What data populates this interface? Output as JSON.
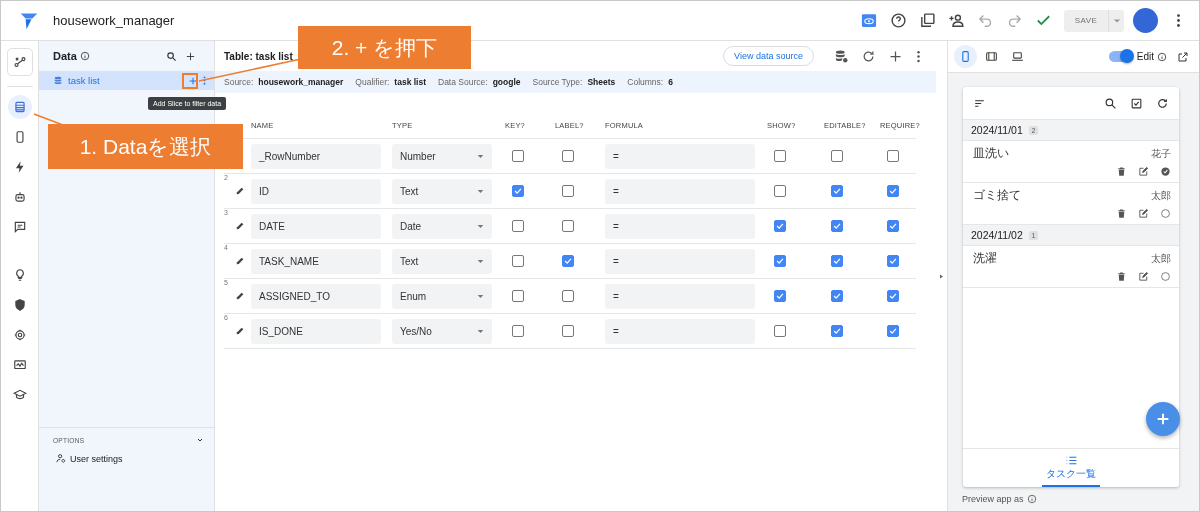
{
  "app": {
    "title": "housework_manager",
    "save": {
      "label": "SAVE",
      "disabled": true
    }
  },
  "rail": {
    "top": {
      "kind": "flow",
      "selected": false
    },
    "groups": [
      [
        {
          "kind": "data",
          "selected": true
        },
        {
          "kind": "phone",
          "selected": false
        },
        {
          "kind": "bolt",
          "selected": false
        },
        {
          "kind": "bot",
          "selected": false
        },
        {
          "kind": "chat",
          "selected": false
        }
      ],
      [
        {
          "kind": "bulb",
          "selected": false
        },
        {
          "kind": "shield",
          "selected": false
        },
        {
          "kind": "gear",
          "selected": false
        },
        {
          "kind": "monitor",
          "selected": false
        },
        {
          "kind": "school",
          "selected": false
        }
      ]
    ]
  },
  "data_panel": {
    "title": "Data",
    "tables": [
      {
        "label": "task list",
        "selected": true
      }
    ],
    "tooltip": "Add Slice to filter data",
    "options": {
      "title": "OPTIONS",
      "items": [
        "User settings"
      ]
    }
  },
  "table": {
    "title": "Table: task list",
    "view_button": "View data source",
    "info": [
      {
        "label": "Source:",
        "value": "housework_manager"
      },
      {
        "label": "Qualifier:",
        "value": "task list"
      },
      {
        "label": "Data Source:",
        "value": "google"
      },
      {
        "label": "Source Type:",
        "value": "Sheets"
      },
      {
        "label": "Columns:",
        "value": "6"
      }
    ],
    "columns": [
      "NAME",
      "TYPE",
      "KEY?",
      "LABEL?",
      "FORMULA",
      "SHOW?",
      "EDITABLE?",
      "REQUIRE?"
    ],
    "rows": [
      {
        "name": "_RowNumber",
        "type": "Number",
        "key": false,
        "label": false,
        "formula": "=",
        "show": false,
        "editable": false,
        "require": false
      },
      {
        "number": "2",
        "name": "ID",
        "type": "Text",
        "key": true,
        "label": false,
        "formula": "=",
        "show": false,
        "editable": true,
        "require": true
      },
      {
        "number": "3",
        "name": "DATE",
        "type": "Date",
        "key": false,
        "label": false,
        "formula": "=",
        "show": true,
        "editable": true,
        "require": true
      },
      {
        "number": "4",
        "name": "TASK_NAME",
        "type": "Text",
        "key": false,
        "label": true,
        "formula": "=",
        "show": true,
        "editable": true,
        "require": true
      },
      {
        "number": "5",
        "name": "ASSIGNED_TO",
        "type": "Enum",
        "key": false,
        "label": false,
        "formula": "=",
        "show": true,
        "editable": true,
        "require": true
      },
      {
        "number": "6",
        "name": "IS_DONE",
        "type": "Yes/No",
        "key": false,
        "label": false,
        "formula": "=",
        "show": false,
        "editable": true,
        "require": true
      }
    ]
  },
  "preview": {
    "devices": [
      {
        "kind": "phone",
        "selected": true
      },
      {
        "kind": "tablet",
        "selected": false
      },
      {
        "kind": "laptop",
        "selected": false
      }
    ],
    "edit_toggle": {
      "label": "Edit",
      "on": true
    },
    "groups": [
      {
        "date": "2024/11/01",
        "count": "2",
        "items": [
          {
            "task": "皿洗い",
            "assignee": "花子",
            "done": true
          },
          {
            "task": "ゴミ捨て",
            "assignee": "太郎",
            "done": false
          }
        ]
      },
      {
        "date": "2024/11/02",
        "count": "1",
        "items": [
          {
            "task": "洗濯",
            "assignee": "太郎",
            "done": false
          }
        ]
      }
    ],
    "nav": [
      {
        "label": "タスク一覧",
        "selected": true
      }
    ],
    "footer": "Preview app as"
  },
  "annotations": [
    {
      "text": "2. + を押下"
    },
    {
      "text": "1. Dataを選択"
    }
  ]
}
